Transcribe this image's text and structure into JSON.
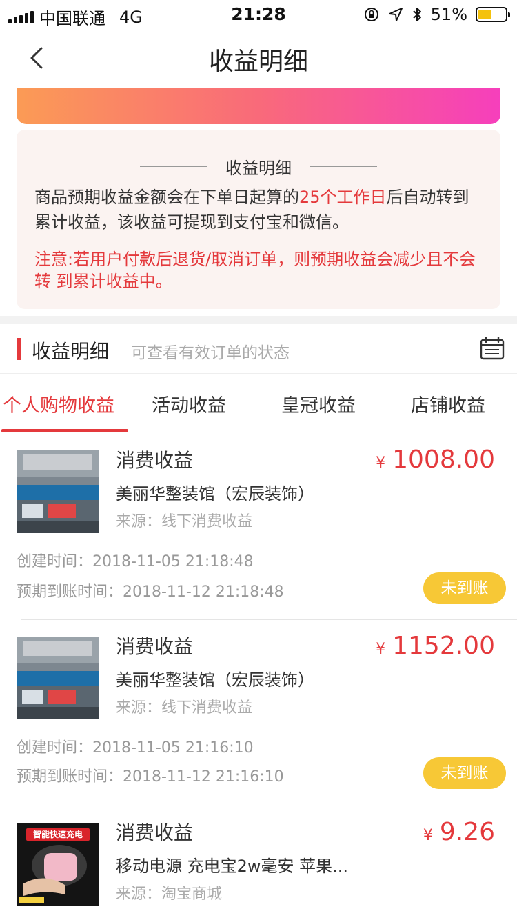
{
  "status_bar": {
    "carrier": "中国联通",
    "network": "4G",
    "time": "21:28",
    "battery": "51%",
    "battery_level": 0.51
  },
  "nav": {
    "title": "收益明细",
    "back_icon": "chevron-left-icon"
  },
  "notice": {
    "title": "收益明细",
    "desc_before": "商品预期收益金额会在下单日起算的",
    "desc_highlight": "25个工作日",
    "desc_after": "后自动转到 累计收益，该收益可提现到支付宝和微信。",
    "warning": "注意:若用户付款后退货/取消订单，则预期收益会减少且不会转 到累计收益中。"
  },
  "section": {
    "title": "收益明细",
    "subtitle": "可查看有效订单的状态",
    "calendar_icon": "calendar-icon"
  },
  "tabs": [
    {
      "label": "个人购物收益",
      "active": true
    },
    {
      "label": "活动收益",
      "active": false
    },
    {
      "label": "皇冠收益",
      "active": false
    },
    {
      "label": "店铺收益",
      "active": false
    }
  ],
  "items": [
    {
      "type": "消费收益",
      "shop": "美丽华整装馆（宏辰装饰）",
      "source": "来源：线下消费收益",
      "currency": "¥",
      "amount": "1008.00",
      "created": "创建时间：2018-11-05 21:18:48",
      "expected": "预期到账时间：2018-11-12 21:18:48",
      "status": "未到账"
    },
    {
      "type": "消费收益",
      "shop": "美丽华整装馆（宏辰装饰）",
      "source": "来源：线下消费收益",
      "currency": "¥",
      "amount": "1152.00",
      "created": "创建时间：2018-11-05 21:16:10",
      "expected": "预期到账时间：2018-11-12 21:16:10",
      "status": "未到账"
    },
    {
      "type": "消费收益",
      "shop": "移动电源 充电宝2w毫安 苹果...",
      "source": "来源：淘宝商城",
      "currency": "¥",
      "amount": "9.26",
      "thumb_label": "智能快速充电"
    }
  ],
  "colors": {
    "accent": "#e4393c",
    "badge": "#f7c836",
    "gradient_start": "#fb9b55",
    "gradient_end": "#f63fbc"
  }
}
